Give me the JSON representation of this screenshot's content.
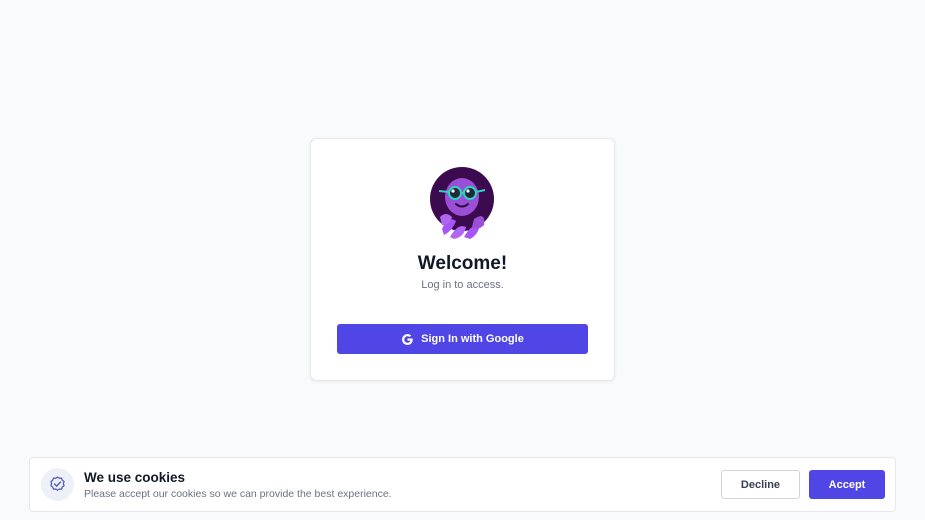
{
  "login": {
    "mascot_icon": "octopus-with-glasses-icon",
    "title": "Welcome!",
    "subtitle": "Log in to access.",
    "google_button": {
      "icon": "google-g-icon",
      "label": "Sign In with Google"
    }
  },
  "cookie_banner": {
    "icon": "check-badge-icon",
    "title": "We use cookies",
    "text": "Please accept our cookies so we can provide the best experience.",
    "decline_label": "Decline",
    "accept_label": "Accept"
  },
  "colors": {
    "primary": "#4f46e5",
    "background": "#f9fafb",
    "card": "#ffffff",
    "text_muted": "#6b7280"
  }
}
